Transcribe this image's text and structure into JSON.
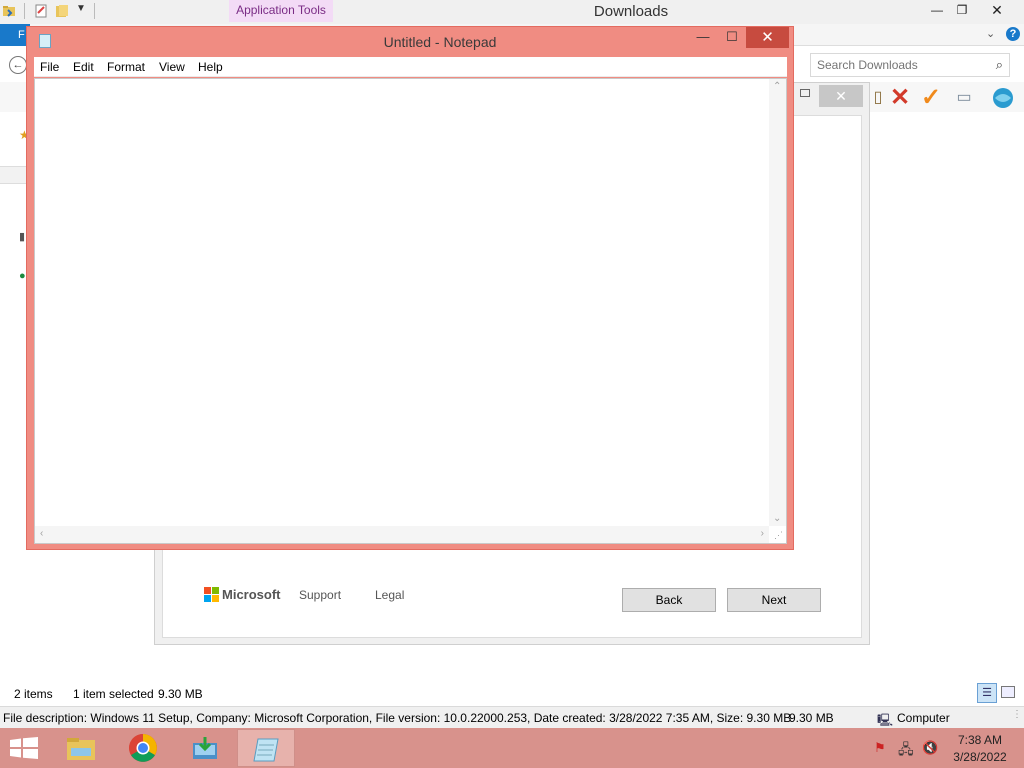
{
  "explorer": {
    "title": "Downloads",
    "context_tab": "Application Tools",
    "file_tab": "F",
    "search_placeholder": "Search Downloads",
    "status_items": "2 items",
    "status_selected": "1 item selected",
    "status_size": "9.30 MB",
    "details_bar": "File description: Windows 11 Setup, Company: Microsoft Corporation, File version: 10.0.22000.253, Date created: 3/28/2022 7:35 AM, Size: 9.30 MB",
    "details_size": "9.30 MB",
    "details_location": "Computer"
  },
  "setup_dialog": {
    "brand": "Microsoft",
    "support_link": "Support",
    "legal_link": "Legal",
    "back_button": "Back",
    "next_button": "Next"
  },
  "notepad": {
    "title": "Untitled - Notepad",
    "menus": [
      "File",
      "Edit",
      "Format",
      "View",
      "Help"
    ],
    "content": ""
  },
  "taskbar": {
    "time": "7:38 AM",
    "date": "3/28/2022"
  },
  "colors": {
    "notepad_frame": "#f08c82",
    "taskbar": "#d8928c",
    "file_tab": "#1979ca",
    "context_tab": "#f3dbf6"
  },
  "icons": [
    "start-icon",
    "file-explorer-icon",
    "chrome-icon",
    "setup-icon",
    "notepad-icon",
    "search-icon",
    "help-icon",
    "red-x-icon",
    "check-icon",
    "network-icon",
    "volume-muted-icon",
    "flag-icon"
  ]
}
